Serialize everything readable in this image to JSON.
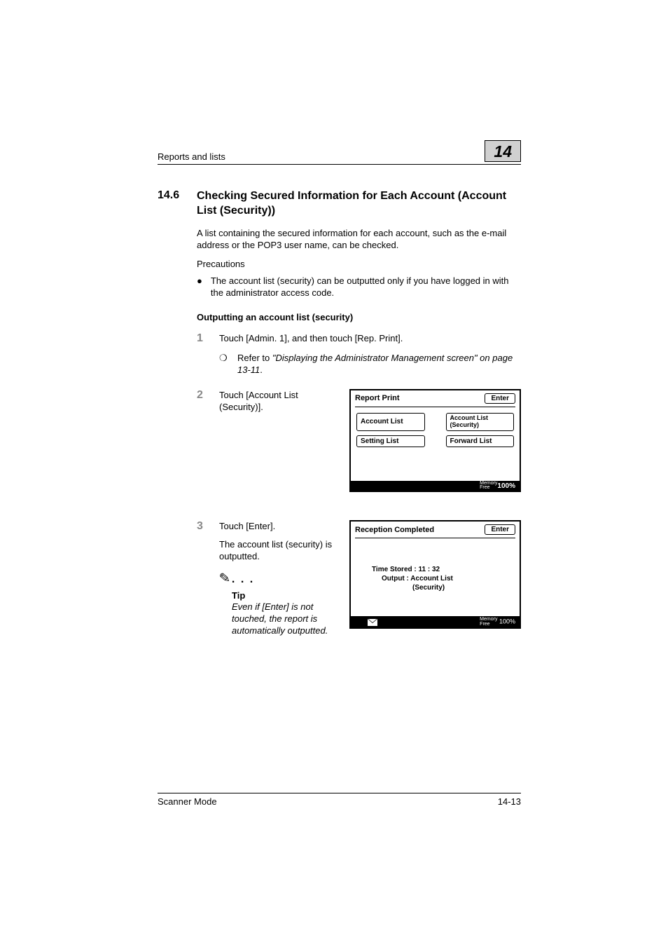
{
  "header": {
    "left": "Reports and lists",
    "chapter": "14"
  },
  "section": {
    "number": "14.6",
    "title": "Checking Secured Information for Each Account (Account List (Security))"
  },
  "intro": "A list containing the secured information for each account, such as the e-mail address or the POP3 user name, can be checked.",
  "precautions_label": "Precautions",
  "bullet1": "The account list (security) can be outputted only if you have logged in with the administrator access code.",
  "subheading": "Outputting an account list (security)",
  "step1": {
    "num": "1",
    "text": "Touch [Admin. 1], and then touch [Rep. Print].",
    "sub_mark": "❍",
    "sub_prefix": "Refer to ",
    "sub_italic": "\"Displaying the Administrator Management screen\" on page 13-11",
    "sub_suffix": "."
  },
  "step2": {
    "num": "2",
    "text": "Touch [Account List (Security)]."
  },
  "panel1": {
    "title": "Report Print",
    "enter": "Enter",
    "c1": "Account List",
    "c2": "Account List (Security)",
    "c3": "Setting List",
    "c4": "Forward List",
    "mem_label": "Memory\nFree",
    "mem_pct": "100%"
  },
  "step3": {
    "num": "3",
    "text1": "Touch [Enter].",
    "text2": "The account list (security) is outputted.",
    "tip_label": "Tip",
    "tip_text": "Even if [Enter] is not touched, the report is automatically outputted."
  },
  "panel2": {
    "title": "Reception Completed",
    "enter": "Enter",
    "line1": "Time Stored : 11 : 32",
    "line2a": "Output : Account List",
    "line2b": "(Security)",
    "mem_label": "Memory\nFree",
    "mem_pct": "100%"
  },
  "footer": {
    "left": "Scanner Mode",
    "right": "14-13"
  }
}
